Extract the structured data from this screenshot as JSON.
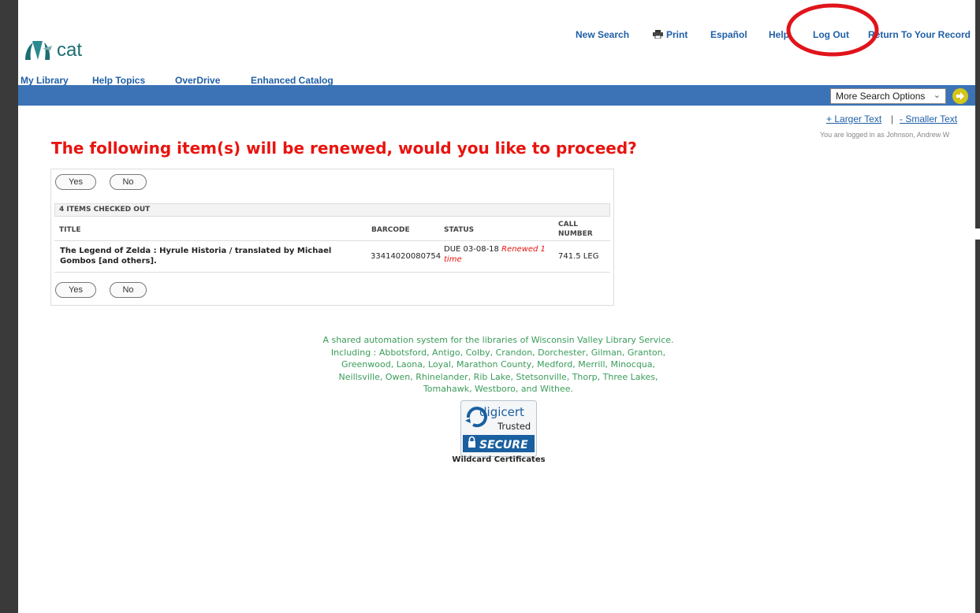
{
  "header": {
    "logo_text": "cat",
    "links": {
      "new_search": "New Search",
      "print": "Print",
      "espanol": "Español",
      "help": "Help",
      "log_out": "Log Out",
      "return_record": "Return To Your Record"
    }
  },
  "tabs": [
    "My Library",
    "Help Topics",
    "OverDrive",
    "Enhanced Catalog"
  ],
  "search_bar": {
    "select_value": "More Search Options"
  },
  "text_size": {
    "larger": "+ Larger Text",
    "separator": "|",
    "smaller": "- Smaller Text"
  },
  "user": {
    "logged_in_text": "You are logged in as Johnson, Andrew W"
  },
  "page": {
    "heading": "The following item(s) will be renewed, would you like to proceed?",
    "yes_label": "Yes",
    "no_label": "No",
    "checked_out_header": "4 ITEMS CHECKED OUT",
    "columns": {
      "title": "TITLE",
      "barcode": "BARCODE",
      "status": "STATUS",
      "call_line1": "CALL",
      "call_line2": "NUMBER"
    },
    "items": [
      {
        "title_line1": "The Legend of Zelda : Hyrule Historia / translated by Michael",
        "title_line2": "Gombos [and others].",
        "barcode": "33414020080754",
        "status_due": "DUE 03-08-18",
        "status_renewed_1": "Renewed 1",
        "status_renewed_2": "time",
        "call_number": "741.5 LEG"
      }
    ]
  },
  "footer": {
    "lines": [
      "A shared automation system for the libraries of Wisconsin Valley Library Service.",
      "Including : Abbotsford, Antigo, Colby, Crandon, Dorchester, Gilman, Granton,",
      "Greenwood, Laona, Loyal, Marathon County, Medford, Merrill, Minocqua,",
      "Neillsville, Owen, Rhinelander, Rib Lake, Stetsonville, Thorp, Three Lakes,",
      "Tomahawk, Westboro, and Withee."
    ],
    "seal": {
      "brand": "digicert",
      "trusted": "Trusted",
      "secure": "SECURE",
      "caption": "Wildcard Certificates"
    }
  },
  "colors": {
    "link_blue": "#1f5fa6",
    "nav_bar": "#3b73b6",
    "heading_red": "#e8140f",
    "footer_green": "#3a9c5a",
    "annotation_red": "#e0141b"
  },
  "icons": [
    "logo-mark",
    "print-icon",
    "chevron-down-icon",
    "go-arrow-icon",
    "lock-icon"
  ]
}
